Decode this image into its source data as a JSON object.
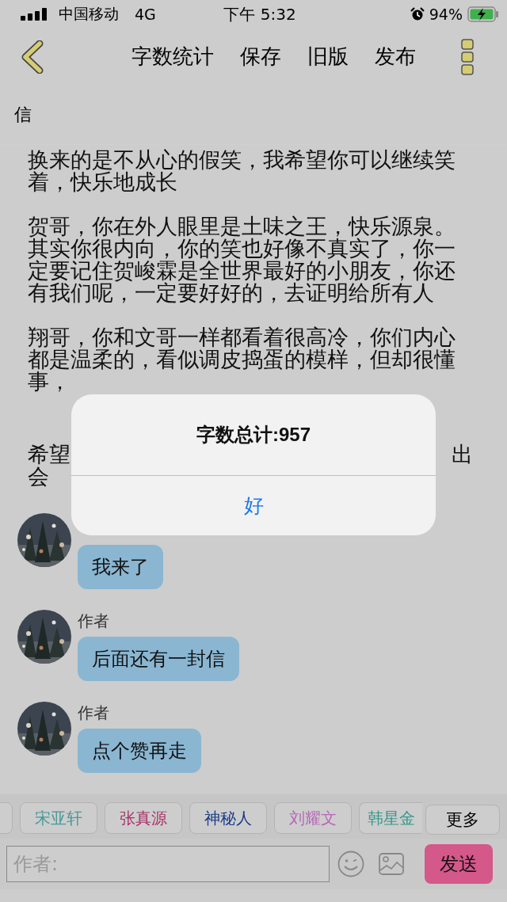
{
  "status_bar": {
    "carrier": "中国移动",
    "network": "4G",
    "time": "下午 5:32",
    "battery": "94%"
  },
  "nav": {
    "actions": [
      "字数统计",
      "保存",
      "旧版",
      "发布"
    ]
  },
  "title": "信",
  "letter": [
    {
      "kind": "text",
      "text": "换来的是不从心的假笑，我希望你可以继续笑着，快乐地成长"
    },
    {
      "kind": "text",
      "text": "贺哥，你在外人眼里是土味之王，快乐源泉。其实你很内向，你的笑也好像不真实了，你一定要记住贺峻霖是全世界最好的小朋友，你还有我们呢，一定要好好的，去证明给所有人"
    },
    {
      "kind": "text",
      "text": "翔哥，你和文哥一样都看着很高冷，你们内心都是温柔的，看似调皮捣蛋的模样，但却很懂事，"
    },
    {
      "kind": "split",
      "left": "希望",
      "right": "出",
      "rest": "会"
    }
  ],
  "messages": [
    {
      "text": "我来了"
    },
    {
      "author": "作者",
      "text": "后面还有一封信"
    },
    {
      "author": "作者",
      "text": "点个赞再走"
    }
  ],
  "tags": [
    {
      "label": "宋亚轩",
      "color": "#4a9898"
    },
    {
      "label": "张真源",
      "color": "#a83368"
    },
    {
      "label": "神秘人",
      "color": "#1a3a88"
    },
    {
      "label": "刘耀文",
      "color": "#b866b8"
    },
    {
      "label": "韩星金",
      "color": "#35988a"
    }
  ],
  "more_button": "更多",
  "input": {
    "placeholder": "作者:"
  },
  "send_button": "发送",
  "alert": {
    "title": "字数总计:957",
    "button": "好"
  }
}
